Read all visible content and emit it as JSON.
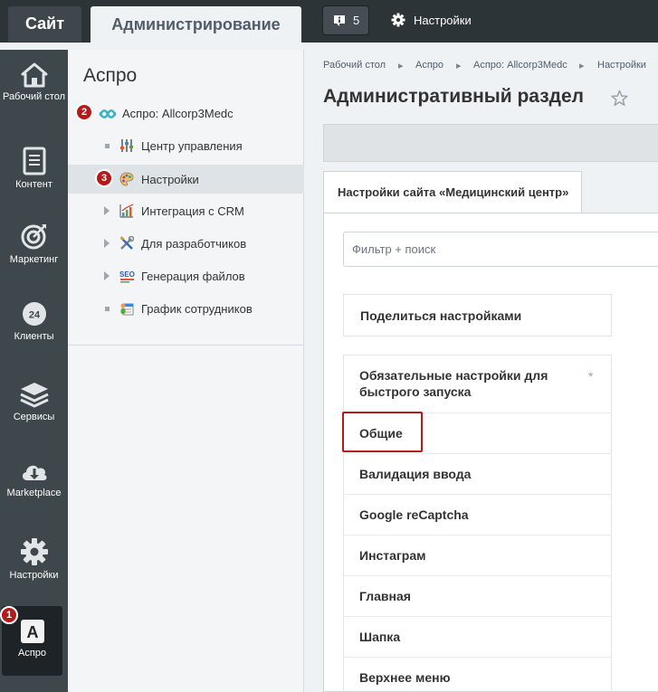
{
  "topbar": {
    "site_tab": "Сайт",
    "admin_tab": "Администрирование",
    "notifications_count": "5",
    "settings_label": "Настройки"
  },
  "leftmenu": {
    "items": [
      {
        "label": "Рабочий стол",
        "icon": "home-icon"
      },
      {
        "label": "Контент",
        "icon": "document-icon"
      },
      {
        "label": "Маркетинг",
        "icon": "target-icon"
      },
      {
        "label": "Клиенты",
        "icon": "clients-24-icon"
      },
      {
        "label": "Сервисы",
        "icon": "layers-icon"
      },
      {
        "label": "Marketplace",
        "icon": "cloud-download-icon"
      },
      {
        "label": "Настройки",
        "icon": "gear-icon"
      },
      {
        "label": "Аспро",
        "icon": "aspro-a-icon"
      }
    ]
  },
  "panel": {
    "title": "Аспро",
    "root_item": "Аспро: Allcorp3Medc",
    "items": [
      {
        "label": "Центр управления",
        "icon": "sliders-icon",
        "expandable": false
      },
      {
        "label": "Настройки",
        "icon": "palette-icon",
        "expandable": false
      },
      {
        "label": "Интеграция с CRM",
        "icon": "chart-icon",
        "expandable": true
      },
      {
        "label": "Для разработчиков",
        "icon": "tools-icon",
        "expandable": true
      },
      {
        "label": "Генерация файлов",
        "icon": "seo-icon",
        "expandable": true
      },
      {
        "label": "График сотрудников",
        "icon": "schedule-icon",
        "expandable": false
      }
    ]
  },
  "breadcrumb": [
    "Рабочий стол",
    "Аспро",
    "Аспро: Allcorp3Medc",
    "Настройки"
  ],
  "page_title": "Административный раздел",
  "tab_label": "Настройки сайта «Медицинский центр»",
  "filter_placeholder": "Фильтр + поиск",
  "share_label": "Поделиться настройками",
  "sections": [
    "Обязательные настройки для быстрого запуска",
    "Общие",
    "Валидация ввода",
    "Google reCaptcha",
    "Инстаграм",
    "Главная",
    "Шапка",
    "Верхнее меню"
  ],
  "annotations": [
    "1",
    "2",
    "3"
  ],
  "colors": {
    "topbar": "#2d3438",
    "leftmenu": "#3e474b",
    "badge": "#b41a1a",
    "highlight": "#b41a1a"
  }
}
